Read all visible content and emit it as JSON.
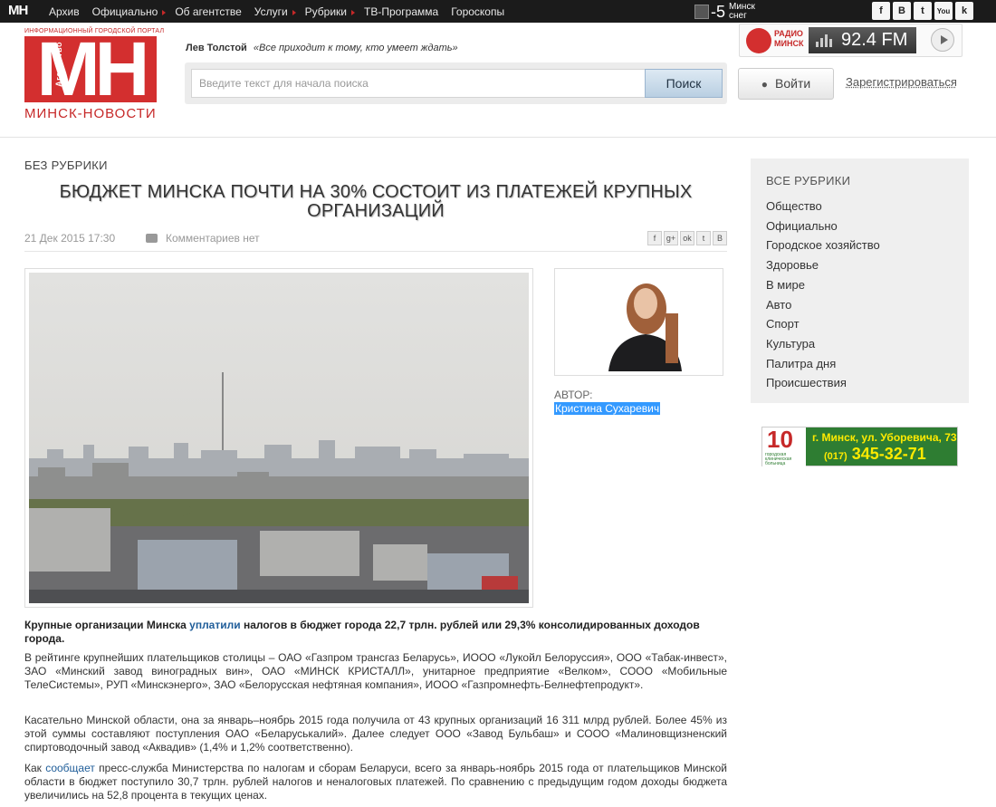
{
  "topnav": {
    "logo": "МН",
    "items": [
      "Архив",
      "Официально",
      "Об агентстве",
      "Услуги",
      "Рубрики",
      "ТВ-Программа",
      "Гороскопы"
    ],
    "weather": {
      "temp": "-5",
      "city": "Минск",
      "condition": "снег"
    },
    "social": [
      "f",
      "B",
      "t",
      "You",
      "k"
    ]
  },
  "header": {
    "portal_caption": "ИНФОРМАЦИОННЫЙ ГОРОДСКОЙ ПОРТАЛ",
    "logo_letters": "МН",
    "agency_word": "Агентство",
    "site_name": "МИНСК-НОВОСТИ",
    "quote_author": "Лев Толстой",
    "quote_text": "«Все приходит к тому, кто умеет ждать»",
    "search_placeholder": "Введите текст для начала поиска",
    "search_button": "Поиск",
    "radio_label_1": "РАДИО",
    "radio_label_2": "МИНСК",
    "radio_freq": "92.4 FM",
    "login_button": "Войти",
    "register_link": "Зарегистрироваться"
  },
  "article": {
    "rubric": "БЕЗ РУБРИКИ",
    "title": "БЮДЖЕТ МИНСКА ПОЧТИ НА 30% СОСТОИТ ИЗ ПЛАТЕЖЕЙ КРУПНЫХ ОРГАНИЗАЦИЙ",
    "date": "21 Дек 2015 17:30",
    "comments": "Комментариев нет",
    "share": [
      "f",
      "g+",
      "ok",
      "t",
      "B"
    ],
    "author_label": "АВТОР:",
    "author_name": "Кристина Сухаревич",
    "lead_before": "Крупные организации Минска ",
    "lead_link": "уплатили",
    "lead_after": "  налогов  в бюджет города 22,7 трлн. рублей или 29,3% консолидированных доходов города.",
    "para1": "В рейтинге крупнейших плательщиков столицы – ОАО «Газпром трансгаз Беларусь», ИООО «Лукойл Белоруссия», ООО «Табак-инвест», ЗАО «Минский завод виноградных вин», ОАО «МИНСК КРИСТАЛЛ», унитарное предприятие «Велком», СООО «Мобильные ТелеСистемы», РУП «Минскэнерго», ЗАО «Белорусская нефтяная компания», ИООО «Газпромнефть-Белнефтепродукт».",
    "para2": "Касательно Минской области, она за январь–ноябрь 2015 года получила от 43 крупных организаций 16 311 млрд рублей. Более 45% из этой суммы составляют поступления ОАО «Беларуськалий». Далее следует ООО «Завод Бульбаш» и СООО «Малиновщизненский спиртоводочный завод «Аквадив» (1,4% и 1,2% соответственно).",
    "para3_before": "Как ",
    "para3_link": "сообщает",
    "para3_after": " пресс-служба Министерства по налогам и сборам Беларуси,  всего за январь-ноябрь 2015 года от плательщиков Минской области в бюджет поступило 30,7 трлн. рублей налогов и неналоговых платежей. По сравнению с предыдущим годом доходы бюджета увеличились на 52,8 процента в текущих ценах."
  },
  "sidebar": {
    "rubrics_head": "ВСЕ РУБРИКИ",
    "rubrics": [
      "Общество",
      "Официально",
      "Городское хозяйство",
      "Здоровье",
      "В мире",
      "Авто",
      "Спорт",
      "Культура",
      "Палитра дня",
      "Происшествия"
    ],
    "ad": {
      "num": "10",
      "caption": "городская клиническая больница",
      "address": "г. Минск, ул. Уборевича, 73",
      "phone_code": "(017)",
      "phone": "345-32-71"
    }
  }
}
